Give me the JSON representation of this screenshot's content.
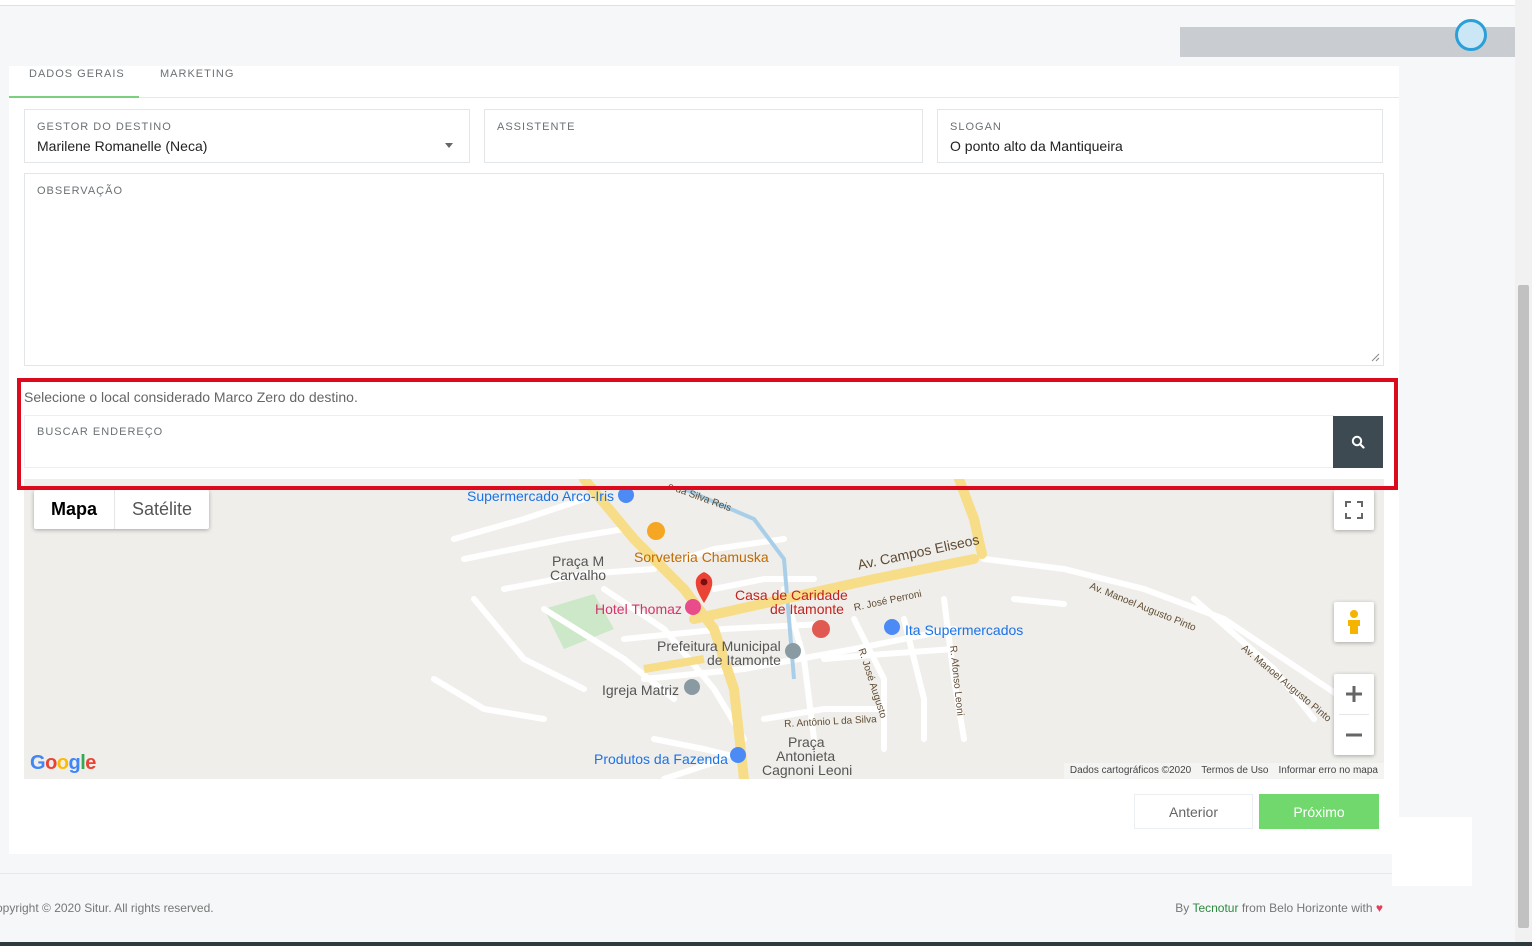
{
  "tabs": [
    {
      "label": "DADOS GERAIS",
      "active": true
    },
    {
      "label": "MARKETING",
      "active": false
    }
  ],
  "form": {
    "gestor": {
      "label": "GESTOR DO DESTINO",
      "value": "Marilene Romanelle (Neca)"
    },
    "assistente": {
      "label": "ASSISTENTE",
      "value": ""
    },
    "slogan": {
      "label": "SLOGAN",
      "value": "O ponto alto da Mantiqueira"
    },
    "observacao": {
      "label": "OBSERVAÇÃO",
      "value": ""
    }
  },
  "location": {
    "hint": "Selecione o local considerado Marco Zero do destino.",
    "search_label": "BUSCAR ENDEREÇO"
  },
  "map": {
    "type_map": "Mapa",
    "type_satellite": "Satélite",
    "places": {
      "supermercado_arco_iris": "Supermercado Arco-Iris",
      "sorveteria": "Sorveteria Chamuska",
      "praca_carvalho_1": "Praça M",
      "praca_carvalho_2": "Carvalho",
      "hotel": "Hotel Thomaz",
      "casa_caridade_1": "Casa de Caridade",
      "casa_caridade_2": "de Itamonte",
      "prefeitura_1": "Prefeitura Municipal",
      "prefeitura_2": "de Itamonte",
      "igreja": "Igreja Matriz",
      "ita_supermercados": "Ita Supermercados",
      "produtos": "Produtos da Fazenda",
      "praca_antonieta_1": "Praça",
      "praca_antonieta_2": "Antonieta",
      "praca_antonieta_3": "Cagnoni Leoni"
    },
    "roads": {
      "campos_eliseos": "Av. Campos Eliseos",
      "manoel_augusto_1": "Av. Manoel Augusto Pinto",
      "manoel_augusto_2": "Av. Manoel Augusto Pinto",
      "jose_perroni": "R. José Perroni",
      "jose_augusto": "R. José Augusto",
      "afonso_leoni": "R. Afonso Leoni",
      "antonio": "R. Antônio L da Silva",
      "silva_reis": "o da Silva Reis"
    },
    "google": "Google",
    "attribution": [
      "Dados cartográficos ©2020",
      "Termos de Uso",
      "Informar erro no mapa"
    ]
  },
  "actions": {
    "prev": "Anterior",
    "next": "Próximo"
  },
  "footer": {
    "copyright": "opyright © 2020 Situr. All rights reserved.",
    "by": "By",
    "brand": "Tecnotur",
    "from": "from Belo Horizonte with",
    "heart": "♥"
  },
  "colors": {
    "accent": "#71d86e",
    "highlight": "#dc0a1d",
    "search_button": "#3d4a52"
  }
}
